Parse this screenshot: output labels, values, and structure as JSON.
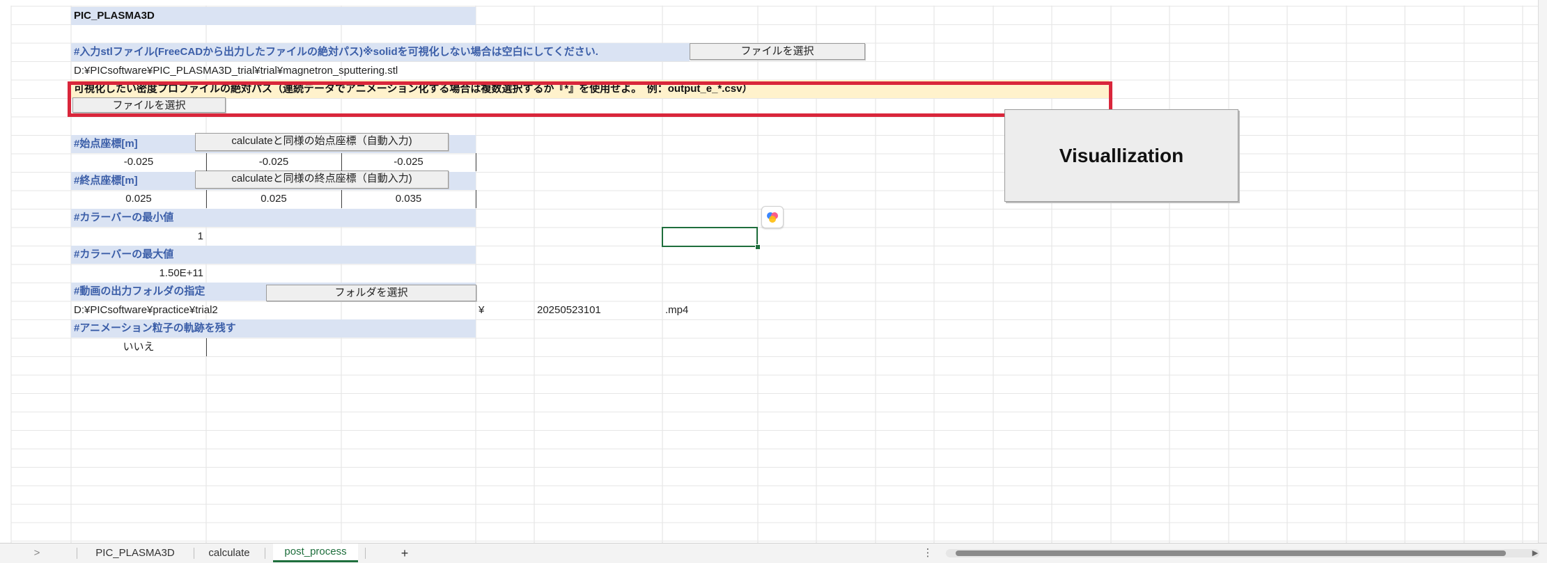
{
  "sheet": {
    "title": "PIC_PLASMA3D",
    "stl_header": "#入力stlファイル(FreeCADから出力したファイルの絶対パス)※solidを可視化しない場合は空白にしてください.",
    "stl_button": "ファイルを選択",
    "stl_path": "D:¥PICsoftware¥PIC_PLASMA3D_trial¥trial¥magnetron_sputtering.stl",
    "density_header": "可視化したい密度プロファイルの絶対パス（連続データでアニメーション化する場合は複数選択するか『*』を使用せよ。　例：output_e_*.csv）",
    "density_button": "ファイルを選択",
    "start_header": "#始点座標[m]",
    "start_button": "calculateと同様の始点座標（自動入力)",
    "start_values": [
      "-0.025",
      "-0.025",
      "-0.025"
    ],
    "end_header": "#終点座標[m]",
    "end_button": "calculateと同様の終点座標（自動入力)",
    "end_values": [
      "0.025",
      "0.025",
      "0.035"
    ],
    "cmin_header": "#カラーバーの最小値",
    "cmin_value": "1",
    "cmax_header": "#カラーバーの最大値",
    "cmax_value": "1.50E+11",
    "folder_header": "#動画の出力フォルダの指定",
    "folder_button": "フォルダを選択",
    "folder_path": "D:¥PICsoftware¥practice¥trial2",
    "yen": "¥",
    "filename": "20250523101",
    "ext": ".mp4",
    "trail_header": "#アニメーション粒子の軌跡を残す",
    "trail_value": "いいえ",
    "visualize_button": "Visuallization"
  },
  "tabs": {
    "nav": ">",
    "items": [
      "PIC_PLASMA3D",
      "calculate",
      "post_process"
    ],
    "active": "post_process",
    "add": "+",
    "more": "⋮",
    "scroll_left": "◀",
    "scroll_right": "▶"
  },
  "colors": {
    "header_band": "#dae3f3",
    "highlight_band": "#fff2cc",
    "header_text": "#3b5ea8",
    "annotation_box": "#d9263b",
    "active_cell": "#1e6e3c"
  }
}
